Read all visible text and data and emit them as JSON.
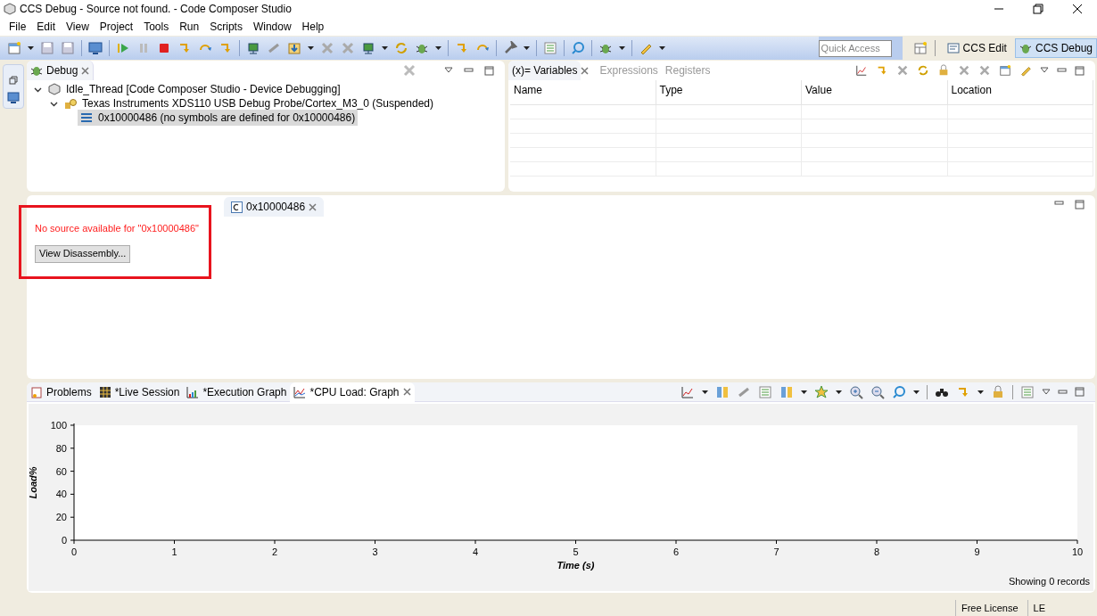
{
  "window": {
    "title": "CCS Debug - Source not found. - Code Composer Studio"
  },
  "menu": [
    "File",
    "Edit",
    "View",
    "Project",
    "Tools",
    "Run",
    "Scripts",
    "Window",
    "Help"
  ],
  "quick_access": {
    "placeholder": "Quick Access"
  },
  "perspectives": [
    {
      "label": "CCS Edit",
      "selected": false
    },
    {
      "label": "CCS Debug",
      "selected": true
    }
  ],
  "debug_view": {
    "tab": "Debug",
    "tree": [
      {
        "label": "Idle_Thread [Code Composer Studio - Device Debugging]",
        "expanded": true,
        "selected": false,
        "children": [
          {
            "label": "Texas Instruments XDS110 USB Debug Probe/Cortex_M3_0 (Suspended)",
            "expanded": true,
            "selected": false,
            "children": [
              {
                "label": "0x10000486  (no symbols are defined for 0x10000486)",
                "selected": true
              }
            ]
          }
        ]
      }
    ]
  },
  "variables_view": {
    "tabs": [
      {
        "label": "(x)= Variables",
        "selected": true
      },
      {
        "label": "Expressions",
        "selected": false
      },
      {
        "label": "Registers",
        "selected": false
      }
    ],
    "columns": [
      "Name",
      "Type",
      "Value",
      "Location"
    ]
  },
  "editor": {
    "tab": "0x10000486",
    "message": "No source available for \"0x10000486\"",
    "button": "View Disassembly..."
  },
  "bottom_view": {
    "tabs": [
      {
        "label": "Problems",
        "selected": false
      },
      {
        "label": "*Live Session",
        "selected": false
      },
      {
        "label": "*Execution Graph",
        "selected": false
      },
      {
        "label": "*CPU Load: Graph",
        "selected": true
      }
    ],
    "chart_data": {
      "type": "line",
      "xlabel": "Time (s)",
      "ylabel": "Load%",
      "xlim": [
        0,
        10
      ],
      "ylim": [
        0,
        100
      ],
      "xticks": [
        0,
        1,
        2,
        3,
        4,
        5,
        6,
        7,
        8,
        9,
        10
      ],
      "yticks": [
        0,
        20,
        40,
        60,
        80,
        100
      ]
    },
    "records": "Showing 0 records"
  },
  "status_bar": [
    "Free License",
    "LE"
  ]
}
